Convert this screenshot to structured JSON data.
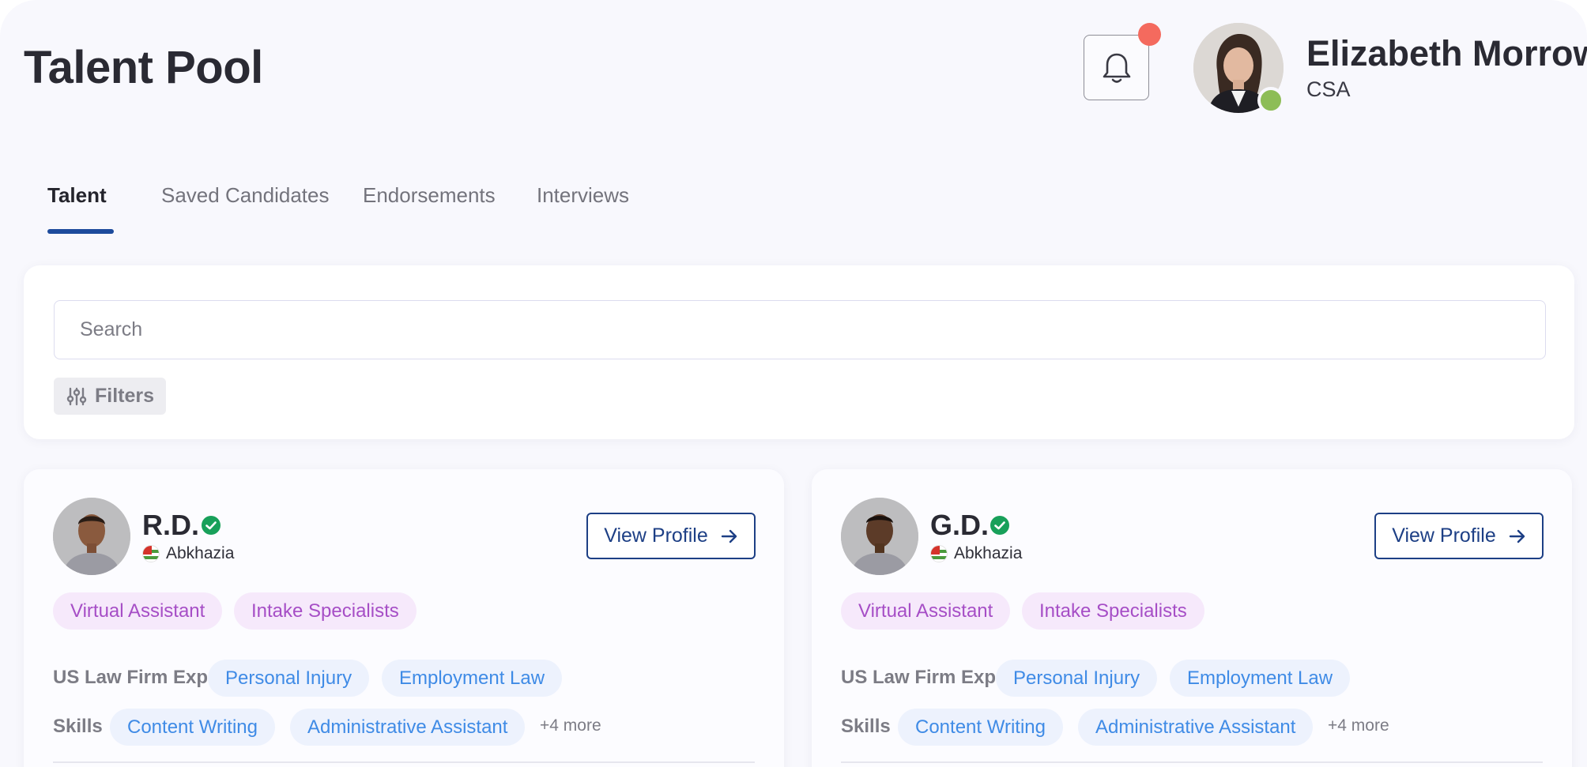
{
  "header": {
    "title": "Talent Pool",
    "user": {
      "name": "Elizabeth Morrow",
      "role": "CSA",
      "status": "online"
    }
  },
  "tabs": [
    {
      "label": "Talent",
      "active": true
    },
    {
      "label": "Saved Candidates",
      "active": false
    },
    {
      "label": "Endorsements",
      "active": false
    },
    {
      "label": "Interviews",
      "active": false
    }
  ],
  "search": {
    "placeholder": "Search",
    "value": ""
  },
  "filters": {
    "label": "Filters"
  },
  "candidates": [
    {
      "name": "R.D.",
      "verified": true,
      "country": "Abkhazia",
      "view_label": "View Profile",
      "roles": [
        "Virtual Assistant",
        "Intake Specialists"
      ],
      "law_exp_label": "US Law Firm Exp",
      "law_exp": [
        "Personal Injury",
        "Employment Law"
      ],
      "skills_label": "Skills",
      "skills": [
        "Content Writing",
        "Administrative Assistant"
      ],
      "more": "+4 more"
    },
    {
      "name": "G.D.",
      "verified": true,
      "country": "Abkhazia",
      "view_label": "View Profile",
      "roles": [
        "Virtual Assistant",
        "Intake Specialists"
      ],
      "law_exp_label": "US Law Firm Exp",
      "law_exp": [
        "Personal Injury",
        "Employment Law"
      ],
      "skills_label": "Skills",
      "skills": [
        "Content Writing",
        "Administrative Assistant"
      ],
      "more": "+4 more"
    }
  ],
  "colors": {
    "accent": "#1d3f85",
    "notification": "#f46a5e",
    "online": "#8dbd56",
    "verified": "#18a05a",
    "role_chip_bg": "#f6e9fb",
    "role_chip_text": "#a64ec6",
    "skill_chip_bg": "#edf2fd",
    "skill_chip_text": "#3f8be6"
  },
  "icons": {
    "bell": "bell-icon",
    "filters": "sliders-icon",
    "arrow": "arrow-right-icon",
    "verified": "check-badge-icon",
    "flag": "flag-icon"
  }
}
